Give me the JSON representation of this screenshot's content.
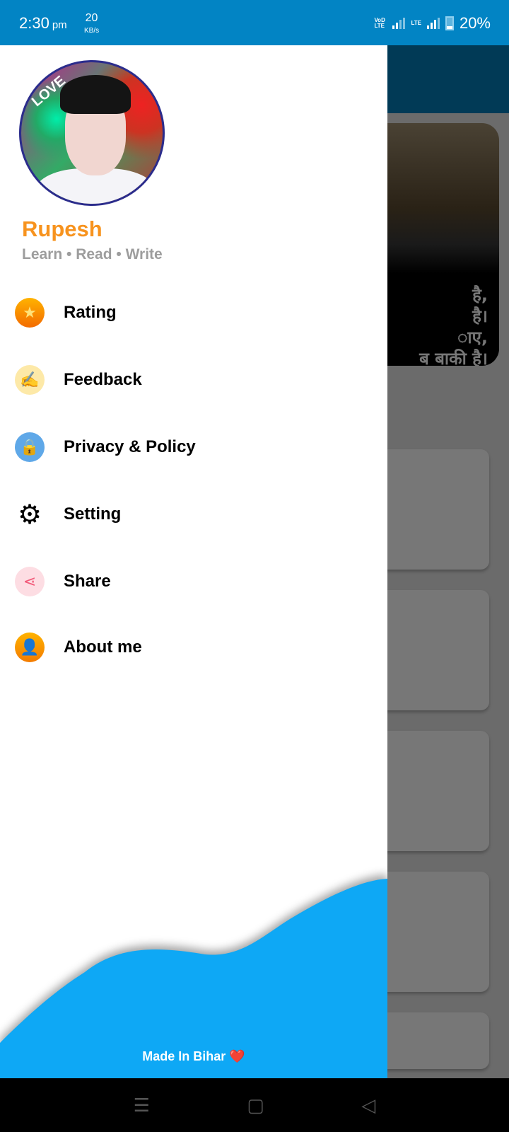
{
  "status_bar": {
    "time": "2:30",
    "ampm": "pm",
    "speed_value": "20",
    "speed_unit": "KB/s",
    "volte": "VoD LTE",
    "lte": "LTE",
    "battery": "20%"
  },
  "background": {
    "quote_lines": [
      "है,",
      "है।",
      "ाए,",
      "ब बाकी है।"
    ]
  },
  "drawer": {
    "profile": {
      "badge": "LOVE",
      "name": "Rupesh",
      "tagline": "Learn • Read • Write"
    },
    "menu": [
      {
        "label": "Rating",
        "icon": "star-icon"
      },
      {
        "label": "Feedback",
        "icon": "feedback-icon"
      },
      {
        "label": "Privacy & Policy",
        "icon": "lock-icon"
      },
      {
        "label": "Setting",
        "icon": "gear-icon"
      },
      {
        "label": "Share",
        "icon": "share-icon"
      },
      {
        "label": "About me",
        "icon": "person-icon"
      }
    ],
    "footer": "Made In Bihar ❤️",
    "wave_color": "#0ea8f5"
  },
  "colors": {
    "status_bar": "#0284c4",
    "name": "#f7931e",
    "accent": "#0ea8f5"
  }
}
